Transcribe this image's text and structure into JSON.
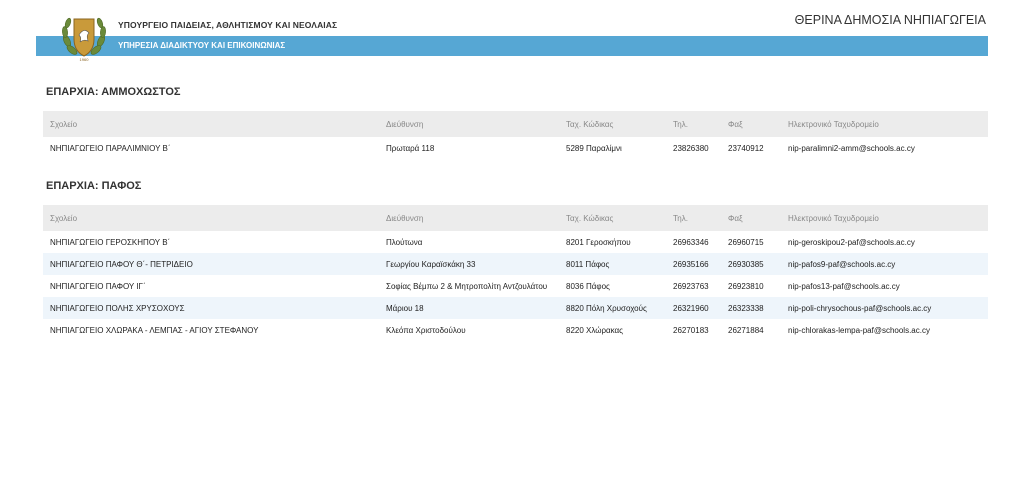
{
  "header": {
    "ministry": "ΥΠΟΥΡΓΕΙΟ ΠΑΙΔΕΙΑΣ, ΑΘΛΗΤΙΣΜΟΥ ΚΑΙ ΝΕΟΛΑΙΑΣ",
    "service": "ΥΠΗΡΕΣΙΑ ΔΙΑΔΙΚΤΥΟΥ ΚΑΙ ΕΠΙΚΟΙΝΩΝΙΑΣ",
    "document_title": "ΘΕΡΙΝΑ ΔΗΜΟΣΙΑ ΝΗΠΙΑΓΩΓΕΙΑ",
    "logo_icon": "cyprus-coat-of-arms-icon",
    "band_color": "#56a7d4"
  },
  "columns": [
    "Σχολείο",
    "Διεύθυνση",
    "Ταχ. Κώδικας",
    "Τηλ.",
    "Φαξ",
    "Ηλεκτρονικό Ταχυδρομείο"
  ],
  "sections": [
    {
      "title": "ΕΠΑΡΧΙΑ: ΑΜΜΟΧΩΣΤΟΣ",
      "rows": [
        [
          "ΝΗΠΙΑΓΩΓΕΙΟ ΠΑΡΑΛΙΜΝΙΟΥ Β΄",
          "Πρωταρά 118",
          "5289 Παραλίμνι",
          "23826380",
          "23740912",
          "nip-paralimni2-amm@schools.ac.cy"
        ]
      ]
    },
    {
      "title": "ΕΠΑΡΧΙΑ: ΠΑΦΟΣ",
      "rows": [
        [
          "ΝΗΠΙΑΓΩΓΕΙΟ ΓΕΡΟΣΚΗΠΟΥ Β΄",
          "Πλούτωνα",
          "8201 Γεροσκήπου",
          "26963346",
          "26960715",
          "nip-geroskipou2-paf@schools.ac.cy"
        ],
        [
          "ΝΗΠΙΑΓΩΓΕΙΟ ΠΑΦΟΥ Θ΄- ΠΕΤΡΙΔΕΙΟ",
          "Γεωργίου Καραϊσκάκη 33",
          "8011 Πάφος",
          "26935166",
          "26930385",
          "nip-pafos9-paf@schools.ac.cy"
        ],
        [
          "ΝΗΠΙΑΓΩΓΕΙΟ ΠΑΦΟΥ ΙΓ΄",
          "Σοφίας Βέμπω 2 & Μητροπολίτη Αντζουλάτου",
          "8036 Πάφος",
          "26923763",
          "26923810",
          "nip-pafos13-paf@schools.ac.cy"
        ],
        [
          "ΝΗΠΙΑΓΩΓΕΙΟ ΠΟΛΗΣ ΧΡΥΣΟΧΟΥΣ",
          "Μάριου 18",
          "8820 Πόλη Χρυσοχούς",
          "26321960",
          "26323338",
          "nip-poli-chrysochous-paf@schools.ac.cy"
        ],
        [
          "ΝΗΠΙΑΓΩΓΕΙΟ ΧΛΩΡΑΚΑ - ΛΕΜΠΑΣ - ΑΓΙΟΥ ΣΤΕΦΑΝΟΥ",
          "Κλεόπα Χριστοδούλου",
          "8220 Χλώρακας",
          "26270183",
          "26271884",
          "nip-chlorakas-lempa-paf@schools.ac.cy"
        ]
      ]
    }
  ]
}
